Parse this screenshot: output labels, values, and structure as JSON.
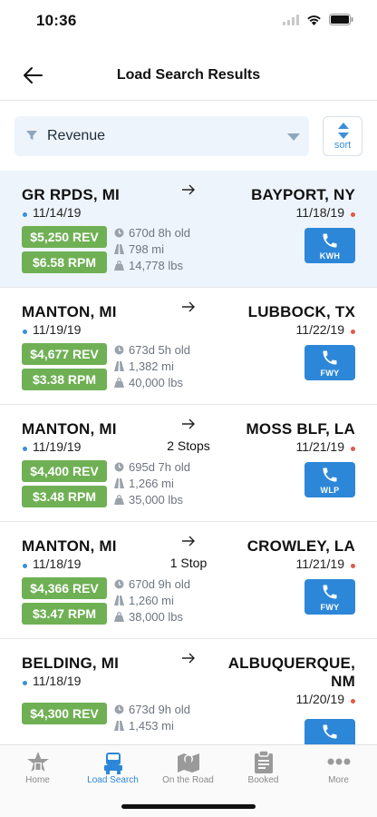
{
  "status_bar": {
    "time": "10:36"
  },
  "header": {
    "title": "Load Search Results"
  },
  "filter": {
    "selected": "Revenue",
    "sort_label": "sort"
  },
  "loads": [
    {
      "origin": "GR RPDS, MI",
      "origin_date": "11/14/19",
      "dest_lines": [
        "BAYPORT, NY"
      ],
      "dest_date": "11/18/19",
      "stops": "",
      "rev": "$5,250 REV",
      "rpm": "$6.58 RPM",
      "age": "670d 8h old",
      "miles": "798 mi",
      "weight": "14,778 lbs",
      "carrier": "KWH",
      "selected": true
    },
    {
      "origin": "MANTON, MI",
      "origin_date": "11/19/19",
      "dest_lines": [
        "LUBBOCK, TX"
      ],
      "dest_date": "11/22/19",
      "stops": "",
      "rev": "$4,677 REV",
      "rpm": "$3.38 RPM",
      "age": "673d 5h old",
      "miles": "1,382 mi",
      "weight": "40,000 lbs",
      "carrier": "FWY",
      "selected": false
    },
    {
      "origin": "MANTON, MI",
      "origin_date": "11/19/19",
      "dest_lines": [
        "MOSS BLF, LA"
      ],
      "dest_date": "11/21/19",
      "stops": "2 Stops",
      "rev": "$4,400 REV",
      "rpm": "$3.48 RPM",
      "age": "695d 7h old",
      "miles": "1,266 mi",
      "weight": "35,000 lbs",
      "carrier": "WLP",
      "selected": false
    },
    {
      "origin": "MANTON, MI",
      "origin_date": "11/18/19",
      "dest_lines": [
        "CROWLEY, LA"
      ],
      "dest_date": "11/21/19",
      "stops": "1 Stop",
      "rev": "$4,366 REV",
      "rpm": "$3.47 RPM",
      "age": "670d 9h old",
      "miles": "1,260 mi",
      "weight": "38,000 lbs",
      "carrier": "FWY",
      "selected": false
    },
    {
      "origin": "BELDING, MI",
      "origin_date": "11/18/19",
      "dest_lines": [
        "ALBUQUERQUE,",
        "NM"
      ],
      "dest_date": "11/20/19",
      "stops": "",
      "rev": "$4,300 REV",
      "rpm": "",
      "age": "673d 9h old",
      "miles": "1,453 mi",
      "weight": "",
      "carrier": "",
      "selected": false
    }
  ],
  "tabs": [
    {
      "label": "Home",
      "icon": "home-star-icon",
      "active": false
    },
    {
      "label": "Load Search",
      "icon": "truck-icon",
      "active": true
    },
    {
      "label": "On the Road",
      "icon": "map-pin-icon",
      "active": false
    },
    {
      "label": "Booked",
      "icon": "clipboard-icon",
      "active": false
    },
    {
      "label": "More",
      "icon": "more-dots-icon",
      "active": false
    }
  ],
  "colors": {
    "accent": "#2d87d8",
    "money_badge": "#6fb054",
    "selected_row": "#eef4fb",
    "origin_dot": "#3a8fd9",
    "dest_dot": "#e05a4b"
  }
}
